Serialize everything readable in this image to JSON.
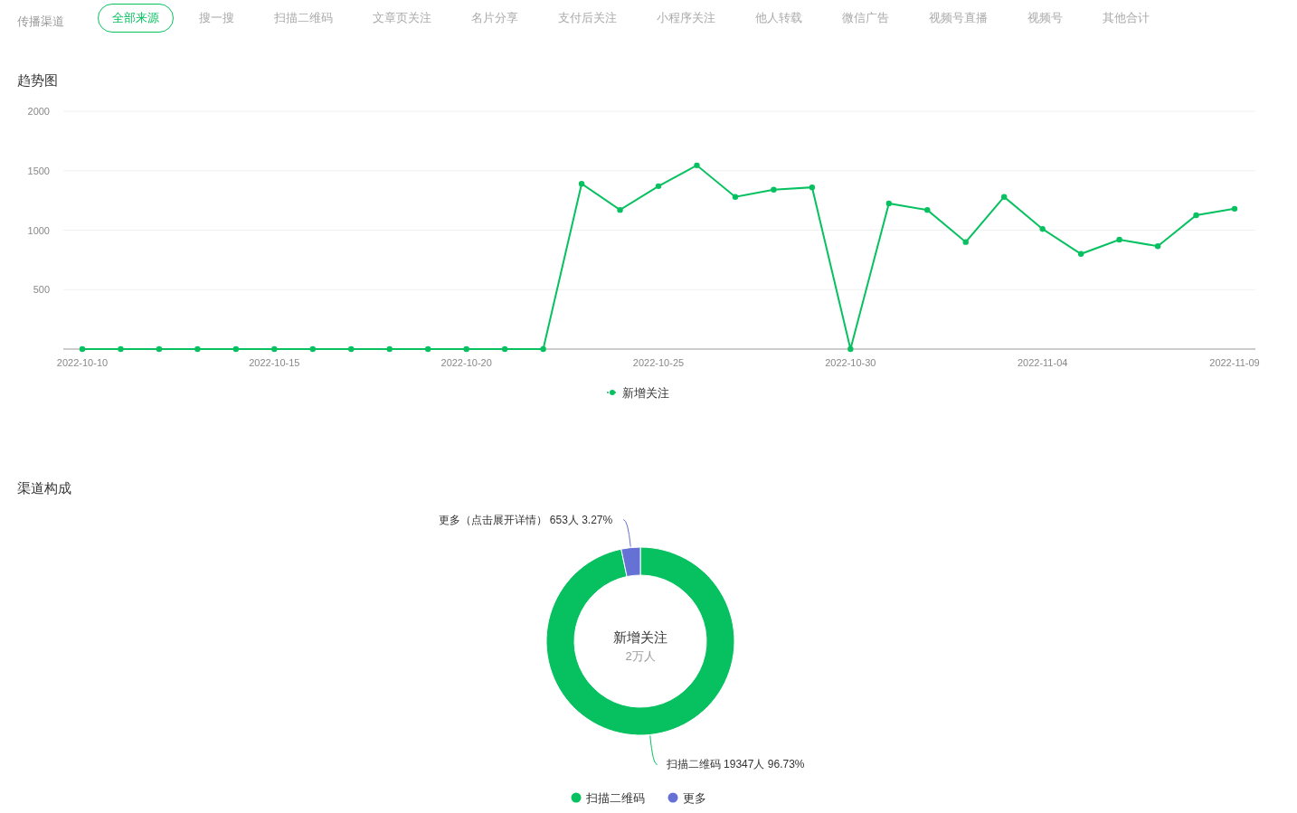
{
  "channel_filter": {
    "label": "传播渠道",
    "tabs": [
      {
        "label": "全部来源",
        "selected": true
      },
      {
        "label": "搜一搜",
        "selected": false
      },
      {
        "label": "扫描二维码",
        "selected": false
      },
      {
        "label": "文章页关注",
        "selected": false
      },
      {
        "label": "名片分享",
        "selected": false
      },
      {
        "label": "支付后关注",
        "selected": false
      },
      {
        "label": "小程序关注",
        "selected": false
      },
      {
        "label": "他人转载",
        "selected": false
      },
      {
        "label": "微信广告",
        "selected": false
      },
      {
        "label": "视频号直播",
        "selected": false
      },
      {
        "label": "视频号",
        "selected": false
      },
      {
        "label": "其他合计",
        "selected": false
      }
    ]
  },
  "trend": {
    "title": "趋势图",
    "chart_data": {
      "type": "line",
      "categories": [
        "2022-10-10",
        null,
        null,
        null,
        null,
        "2022-10-15",
        null,
        null,
        null,
        null,
        "2022-10-20",
        null,
        null,
        null,
        null,
        "2022-10-25",
        null,
        null,
        null,
        null,
        "2022-10-30",
        null,
        null,
        null,
        null,
        "2022-11-04",
        null,
        null,
        null,
        null,
        "2022-11-09"
      ],
      "legend": "bottom",
      "grid": true,
      "series": [
        {
          "name": "新增关注",
          "color": "#07c160",
          "marker": "circle",
          "values": [
            0,
            0,
            0,
            0,
            0,
            0,
            0,
            0,
            0,
            0,
            0,
            0,
            0,
            1390,
            1170,
            1370,
            1545,
            1280,
            1340,
            1360,
            0,
            1225,
            1170,
            900,
            1280,
            1010,
            800,
            920,
            865,
            1125,
            1180
          ]
        }
      ],
      "ylim": [
        0,
        2000
      ],
      "yticks": [
        500,
        1000,
        1500,
        2000
      ]
    }
  },
  "composition": {
    "title": "渠道构成",
    "chart_data": {
      "type": "donut",
      "categories": [
        "扫描二维码",
        "更多"
      ],
      "series": [
        {
          "name": "新增关注",
          "values": [
            96.73,
            3.27
          ]
        }
      ],
      "legend": "bottom",
      "colors": [
        "#07c160",
        "#6571d4"
      ],
      "value_labels": [
        "扫描二维码 19347人 96.73%",
        "更多（点击展开详情） 653人 3.27%"
      ],
      "annotations": [
        {
          "text": "2万人"
        }
      ]
    }
  }
}
